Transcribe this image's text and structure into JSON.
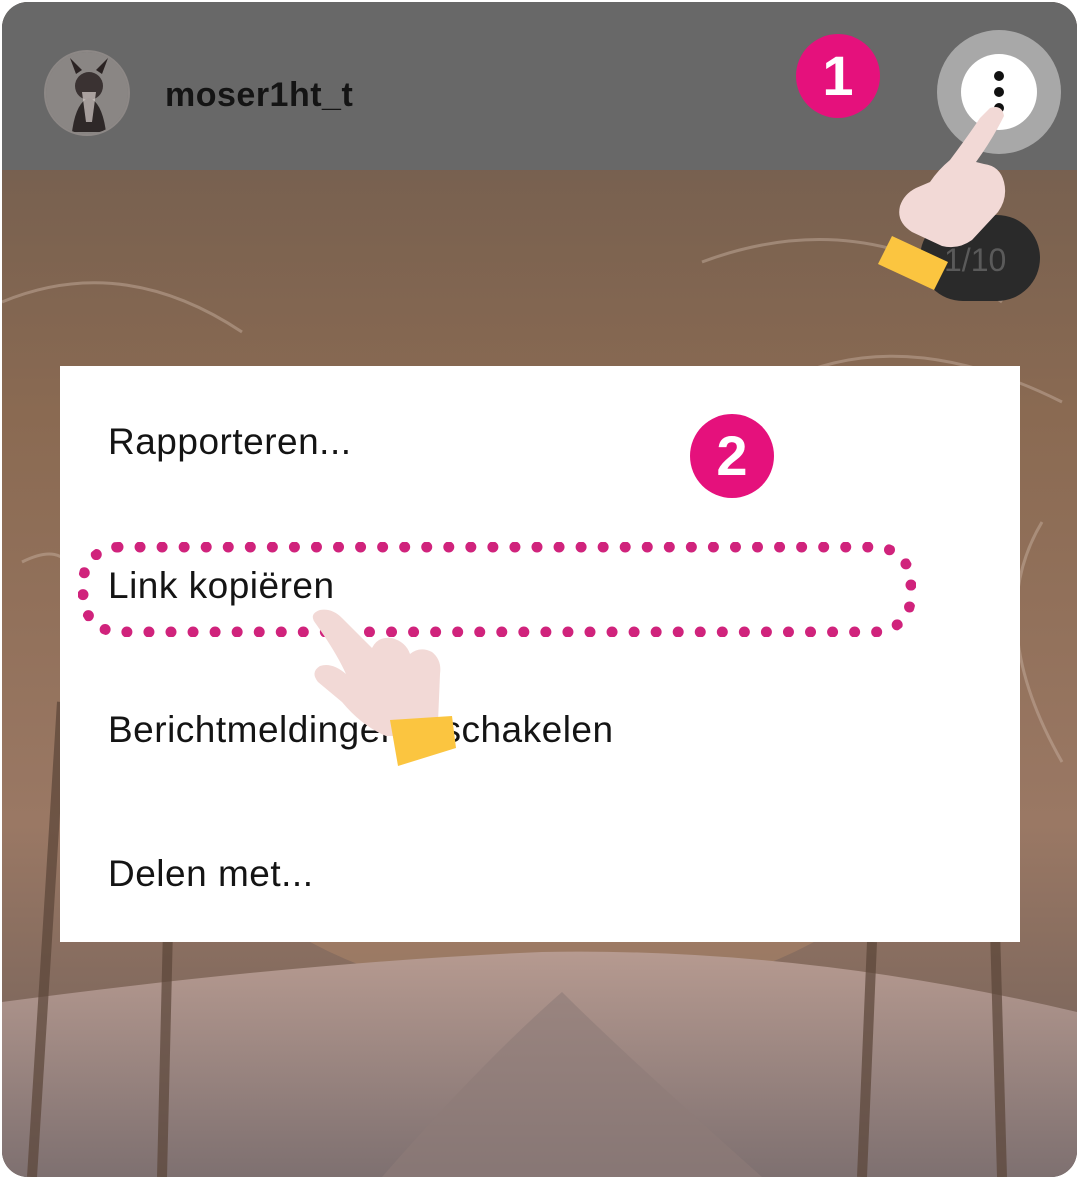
{
  "header": {
    "username": "moser1ht_t",
    "more_icon": "vertical-dots-icon",
    "counter": "1/10"
  },
  "steps": {
    "one": "1",
    "two": "2"
  },
  "menu": {
    "items": [
      {
        "label": "Rapporteren..."
      },
      {
        "label": "Link kopiëren"
      },
      {
        "label": "Berichtmeldingen inschakelen"
      },
      {
        "label": "Delen met..."
      }
    ]
  },
  "colors": {
    "accent": "#e5117c",
    "highlight": "#d0237c",
    "header_bg": "#686868",
    "hand_skin": "#f2d9d6",
    "cuff": "#fbc540"
  }
}
